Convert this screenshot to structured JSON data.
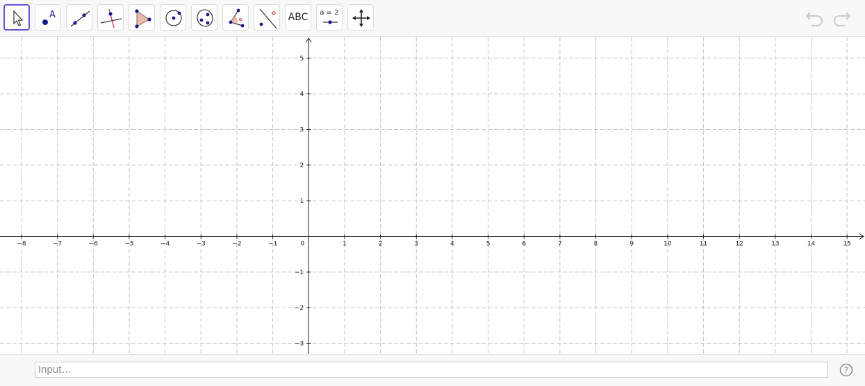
{
  "toolbar": {
    "tools": [
      {
        "name": "move-tool",
        "icon": "pointer-arrow-icon"
      },
      {
        "name": "point-tool",
        "icon": "point-A-icon"
      },
      {
        "name": "line-tool",
        "icon": "line-through-two-points-icon"
      },
      {
        "name": "perpendicular-line-tool",
        "icon": "perpendicular-line-icon"
      },
      {
        "name": "polygon-tool",
        "icon": "polygon-icon"
      },
      {
        "name": "circle-tool",
        "icon": "circle-center-point-icon"
      },
      {
        "name": "conic-tool",
        "icon": "ellipse-icon"
      },
      {
        "name": "angle-tool",
        "icon": "angle-icon"
      },
      {
        "name": "reflect-tool",
        "icon": "reflect-about-line-icon"
      },
      {
        "name": "text-tool",
        "icon": "text-icon",
        "label": "ABC"
      },
      {
        "name": "slider-tool",
        "icon": "slider-icon",
        "label": "a = 2"
      },
      {
        "name": "move-graphics-view-tool",
        "icon": "move-view-icon"
      }
    ],
    "active_tool": "move-tool",
    "undo_icon": "undo-icon",
    "redo_icon": "redo-icon"
  },
  "graphics": {
    "x_range": [
      -8.6,
      15.5
    ],
    "y_range": [
      -3.3,
      5.6
    ],
    "x_ticks": [
      "−8",
      "−7",
      "−6",
      "−5",
      "−4",
      "−3",
      "−2",
      "−1",
      "0",
      "1",
      "2",
      "3",
      "4",
      "5",
      "6",
      "7",
      "8",
      "9",
      "10",
      "11",
      "12",
      "13",
      "14",
      "15"
    ],
    "y_ticks": [
      "5",
      "4",
      "3",
      "2",
      "1",
      "−1",
      "−2",
      "−3"
    ],
    "grid": true,
    "grid_style": "dashed",
    "accent_color": "#6557d2"
  },
  "input_bar": {
    "placeholder": "Input…",
    "help_icon": "help-icon"
  }
}
